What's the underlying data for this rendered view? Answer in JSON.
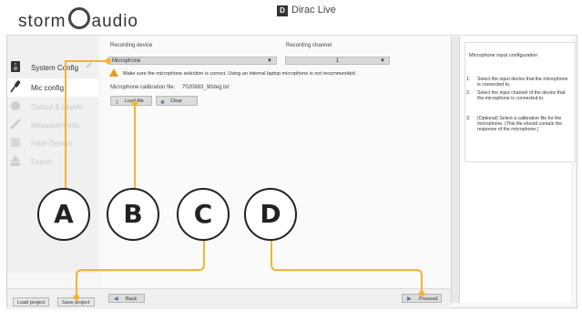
{
  "header": {
    "logo_text": "StormAudio",
    "app_title": "Dirac Live",
    "app_mark": "D"
  },
  "sidebar": {
    "items": [
      {
        "label": "System Config",
        "checked": true
      },
      {
        "label": "Mic config",
        "selected": true
      },
      {
        "label": "Output & Levels"
      },
      {
        "label": "Measurements"
      },
      {
        "label": "Filter Design"
      },
      {
        "label": "Export"
      }
    ]
  },
  "main": {
    "recording_device_label": "Recording device",
    "recording_device_value": "Microphone",
    "recording_channel_label": "Recording channel",
    "recording_channel_value": "1",
    "warning": "Make sure the microphone selection is correct. Using an internal laptop microphone is not recommended.",
    "calibration_label": "Microphone calibration file:",
    "calibration_value": "7020883_90deg.txt",
    "load_file_button": "Load file",
    "clear_button": "Clear"
  },
  "help": {
    "title": "Microphone input configuration",
    "steps": [
      {
        "num": "1.",
        "text": "Select the input device that the microphone is connected to."
      },
      {
        "num": "2.",
        "text": "Select the input channel of the device that the microphone is connected to."
      },
      {
        "num": "3.",
        "text": "(Optional) Select a calibration file for the microphone. (This file should contain the response of the microphone.)"
      }
    ]
  },
  "bottom": {
    "load_project": "Load project",
    "save_project": "Save project",
    "back": "Back",
    "proceed": "Proceed"
  },
  "callouts": {
    "a": "A",
    "b": "B",
    "c": "C",
    "d": "D"
  },
  "colors": {
    "accent_orange": "#f5b335",
    "warning_yellow": "#e2a01a",
    "button_icon_blue": "#4a6fa5"
  }
}
